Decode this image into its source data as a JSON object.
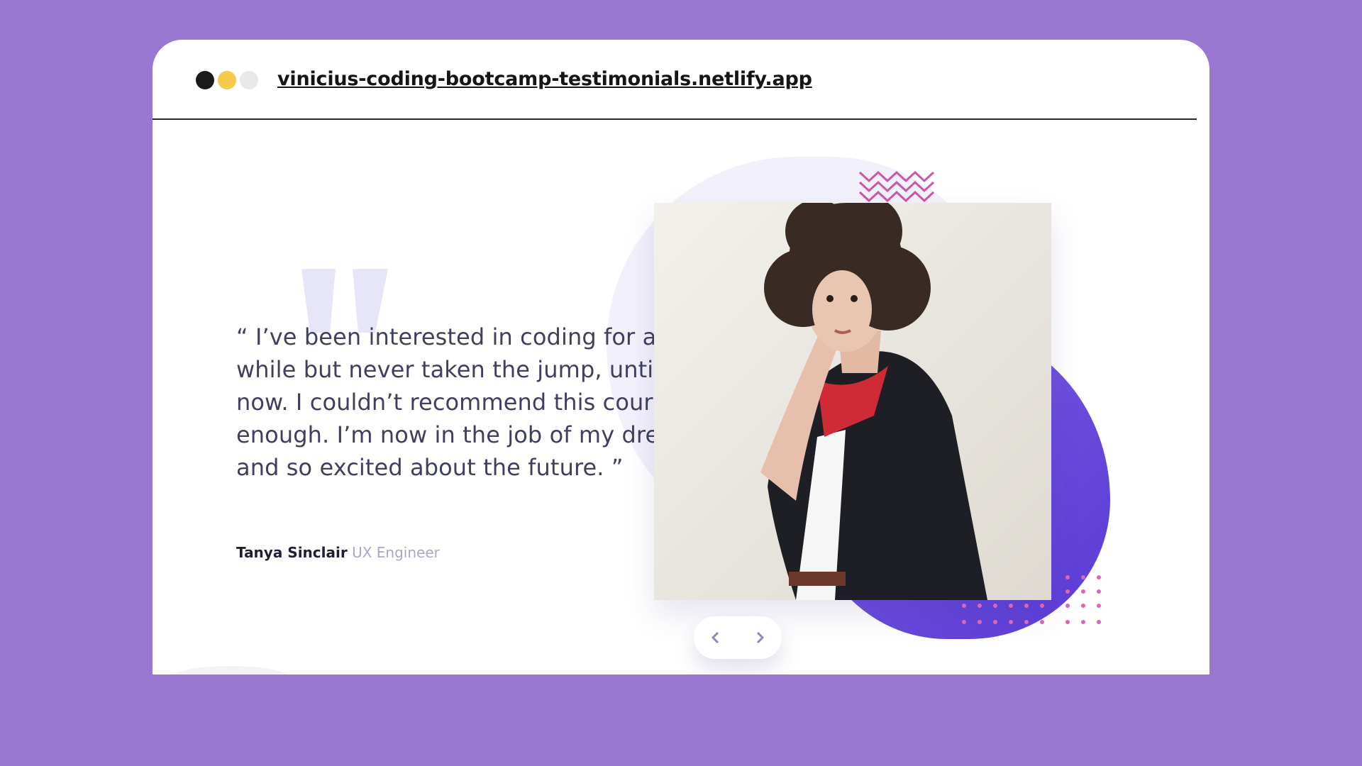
{
  "browser": {
    "url": "vinicius-coding-bootcamp-testimonials.netlify.app",
    "dot_colors": [
      "#1a1a1a",
      "#f6c94b",
      "#e8e8e8"
    ]
  },
  "testimonial": {
    "quote": "“ I’ve been interested in coding for a while but never taken the jump, until now. I couldn’t recommend this course enough. I’m now in the job of my dreams and so excited about the future. ”",
    "name": "Tanya Sinclair",
    "role": "UX Engineer"
  },
  "slider": {
    "prev_icon": "chevron-left-icon",
    "next_icon": "chevron-right-icon"
  },
  "colors": {
    "background": "#9a77d0",
    "accent_purple": "#6a4bdc",
    "accent_pink": "#c957a8",
    "text_dark": "#3f3f5f",
    "text_muted": "#a9a7c8"
  }
}
